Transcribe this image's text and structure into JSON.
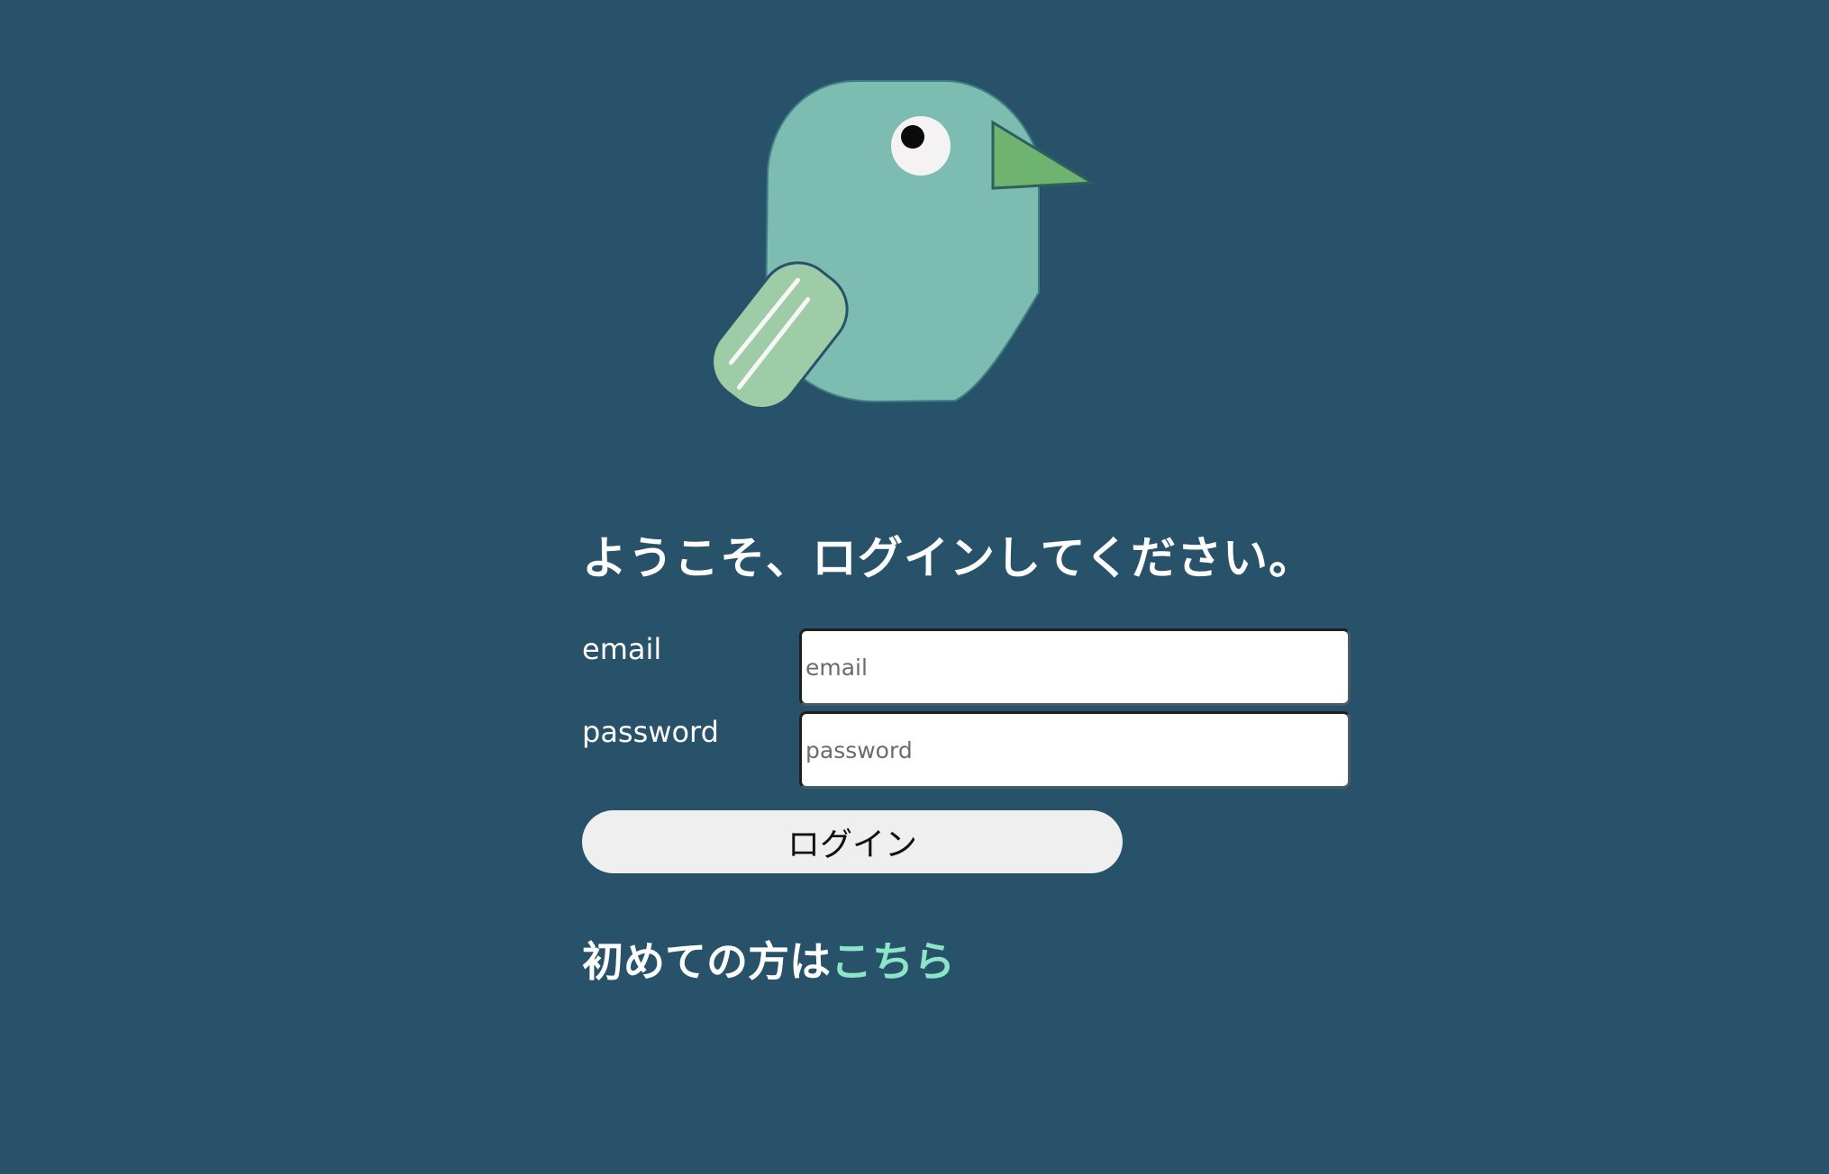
{
  "welcome": {
    "heading": "ようこそ、ログインしてください。"
  },
  "form": {
    "email_label": "email",
    "email_placeholder": "email",
    "password_label": "password",
    "password_placeholder": "password",
    "login_button": "ログイン"
  },
  "signup": {
    "prefix": "初めての方は",
    "link_text": "こちら"
  },
  "colors": {
    "background": "#275269",
    "bird_body": "#7dbcb1",
    "bird_wing": "#9dcca7",
    "bird_beak": "#6eb470",
    "link": "#8be6c9",
    "button_bg": "#efefef"
  },
  "icons": {
    "logo": "bird-logo-icon"
  }
}
